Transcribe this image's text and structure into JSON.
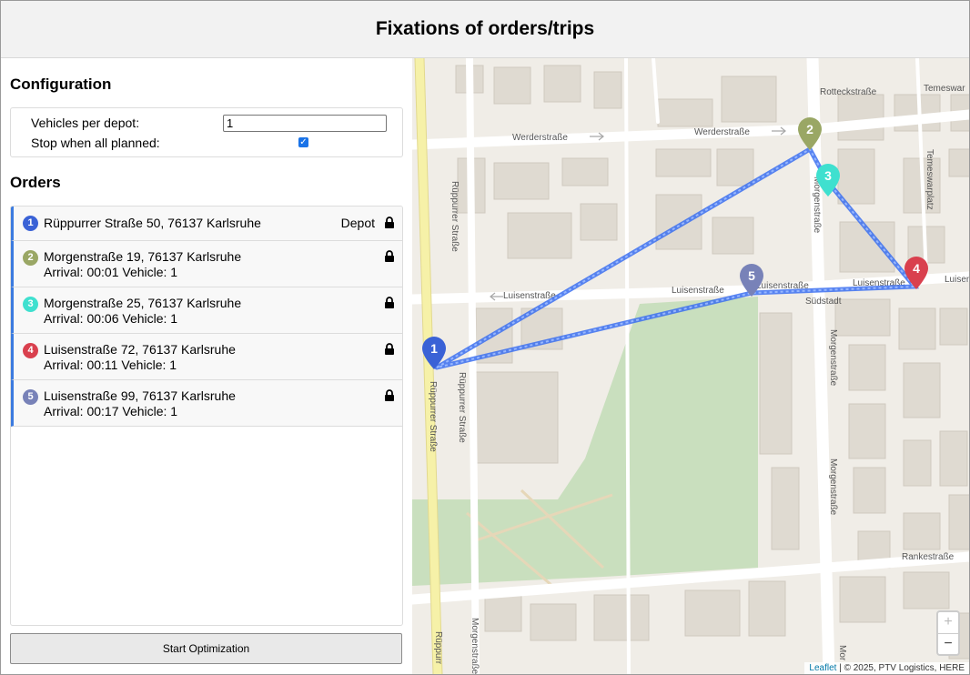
{
  "header": {
    "title": "Fixations of orders/trips"
  },
  "config": {
    "title": "Configuration",
    "vehicles_label": "Vehicles per depot:",
    "vehicles_value": "1",
    "stop_label": "Stop when all planned:",
    "stop_checked": true
  },
  "orders": {
    "title": "Orders",
    "items": [
      {
        "num": "1",
        "color": "#3a62d6",
        "address": "Rüppurrer Straße 50, 76137 Karlsruhe",
        "arrival": "",
        "tag": "Depot"
      },
      {
        "num": "2",
        "color": "#9aa765",
        "address": "Morgenstraße 19, 76137 Karlsruhe",
        "arrival": "Arrival: 00:01 Vehicle: 1",
        "tag": ""
      },
      {
        "num": "3",
        "color": "#3fe0cf",
        "address": "Morgenstraße 25, 76137 Karlsruhe",
        "arrival": "Arrival: 00:06 Vehicle: 1",
        "tag": ""
      },
      {
        "num": "4",
        "color": "#d9404e",
        "address": "Luisenstraße 72, 76137 Karlsruhe",
        "arrival": "Arrival: 00:11 Vehicle: 1",
        "tag": ""
      },
      {
        "num": "5",
        "color": "#7882b8",
        "address": "Luisenstraße 99, 76137 Karlsruhe",
        "arrival": "Arrival: 00:17 Vehicle: 1",
        "tag": ""
      }
    ]
  },
  "buttons": {
    "start": "Start Optimization"
  },
  "map": {
    "streets": {
      "werder_1": "Werderstraße",
      "werder_2": "Werderstraße",
      "rotteck": "Rotteckstraße",
      "temeswar_top": "Temeswar",
      "temeswar_platz": "Temeswarplatz",
      "rueppurrer_1": "Rüppurrer Straße",
      "rueppurrer_2": "Rüppurrer Straße",
      "rueppurrer_3": "Rüppurrer Straße",
      "rueppurrer_4": "Rüppurr",
      "morgen_1": "Morgenstraße",
      "morgen_2": "Morgenstraße",
      "morgen_3": "Morgenstraße",
      "morgen_4": "Morgenstraße",
      "morgen_5": "Mor",
      "luisen_1": "Luisenstraße",
      "luisen_2": "Luisenstraße",
      "luisen_3": "Luisenstraße",
      "luisen_4": "Luisenstraße",
      "luisen_5": "Luisenstraße",
      "suedstadt": "Südstadt",
      "rankestr": "Rankestraße"
    },
    "zoom_in": "+",
    "zoom_out": "−",
    "attribution_link": "Leaflet",
    "attribution_text": " | © 2025, PTV Logistics, HERE",
    "route_color": "#3b6ff0"
  }
}
